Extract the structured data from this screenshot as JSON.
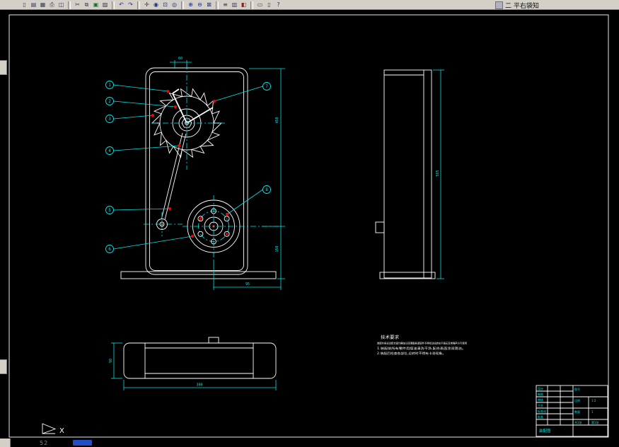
{
  "window": {
    "toolbar_caption": "二 平右袋知",
    "taskbar_label": "52"
  },
  "toolbar": {
    "icons": [
      {
        "name": "new-file",
        "glyph": "▯"
      },
      {
        "name": "open-file",
        "glyph": "▤"
      },
      {
        "name": "save-file",
        "glyph": "▦"
      },
      {
        "name": "print",
        "glyph": "⎙"
      },
      {
        "name": "print-preview",
        "glyph": "◫"
      },
      {
        "name": "cut",
        "glyph": "✂"
      },
      {
        "name": "copy",
        "glyph": "⧉"
      },
      {
        "name": "paste",
        "glyph": "▣"
      },
      {
        "name": "match-properties",
        "glyph": "▨"
      },
      {
        "name": "undo",
        "glyph": "↶"
      },
      {
        "name": "redo",
        "glyph": "↷"
      },
      {
        "name": "pan",
        "glyph": "✛"
      },
      {
        "name": "zoom-realtime",
        "glyph": "◉"
      },
      {
        "name": "zoom-window",
        "glyph": "⊡"
      },
      {
        "name": "zoom-previous",
        "glyph": "◎"
      },
      {
        "name": "zoom-in",
        "glyph": "⊕"
      },
      {
        "name": "zoom-out",
        "glyph": "⊖"
      },
      {
        "name": "zoom-extents",
        "glyph": "⊠"
      },
      {
        "name": "layers",
        "glyph": "≡"
      },
      {
        "name": "layer-properties",
        "glyph": "▥"
      },
      {
        "name": "color-control",
        "glyph": "◧"
      },
      {
        "name": "model-space",
        "glyph": "▭"
      },
      {
        "name": "paper-space",
        "glyph": "▯"
      },
      {
        "name": "help",
        "glyph": "?"
      }
    ]
  },
  "drawing": {
    "balloons": [
      "1",
      "2",
      "3",
      "4",
      "5",
      "6",
      "7",
      "8"
    ],
    "dims": {
      "top": "60",
      "right_upper": "450",
      "right_lower": "150",
      "front_bottom": "95",
      "side_height": "565",
      "plan_depth": "98",
      "plan_width": "300"
    },
    "notes": {
      "title": "技术要求",
      "dense": "装配时各运动配合面均需加注润滑脂各紧固件不得松动运转应平稳无异常噪声方可使用",
      "item1": "1.装配前所有零件用煤油清洗干净,配合表面涂润滑油。",
      "item2": "2.装配后检查各部位,运转时不得有卡滞现象。"
    }
  },
  "ucs": {
    "axis_label": "X"
  },
  "title_block": {
    "rows": [
      "设计",
      "制图",
      "审核",
      "工艺",
      "标准化",
      "批准"
    ],
    "no_label": "图号",
    "scale_label": "比例",
    "scale_value": "1:2",
    "qty_label": "数量",
    "qty_value": "1",
    "sheet_label": "共1张",
    "sheet_value": "第1张",
    "name": "装配图"
  }
}
